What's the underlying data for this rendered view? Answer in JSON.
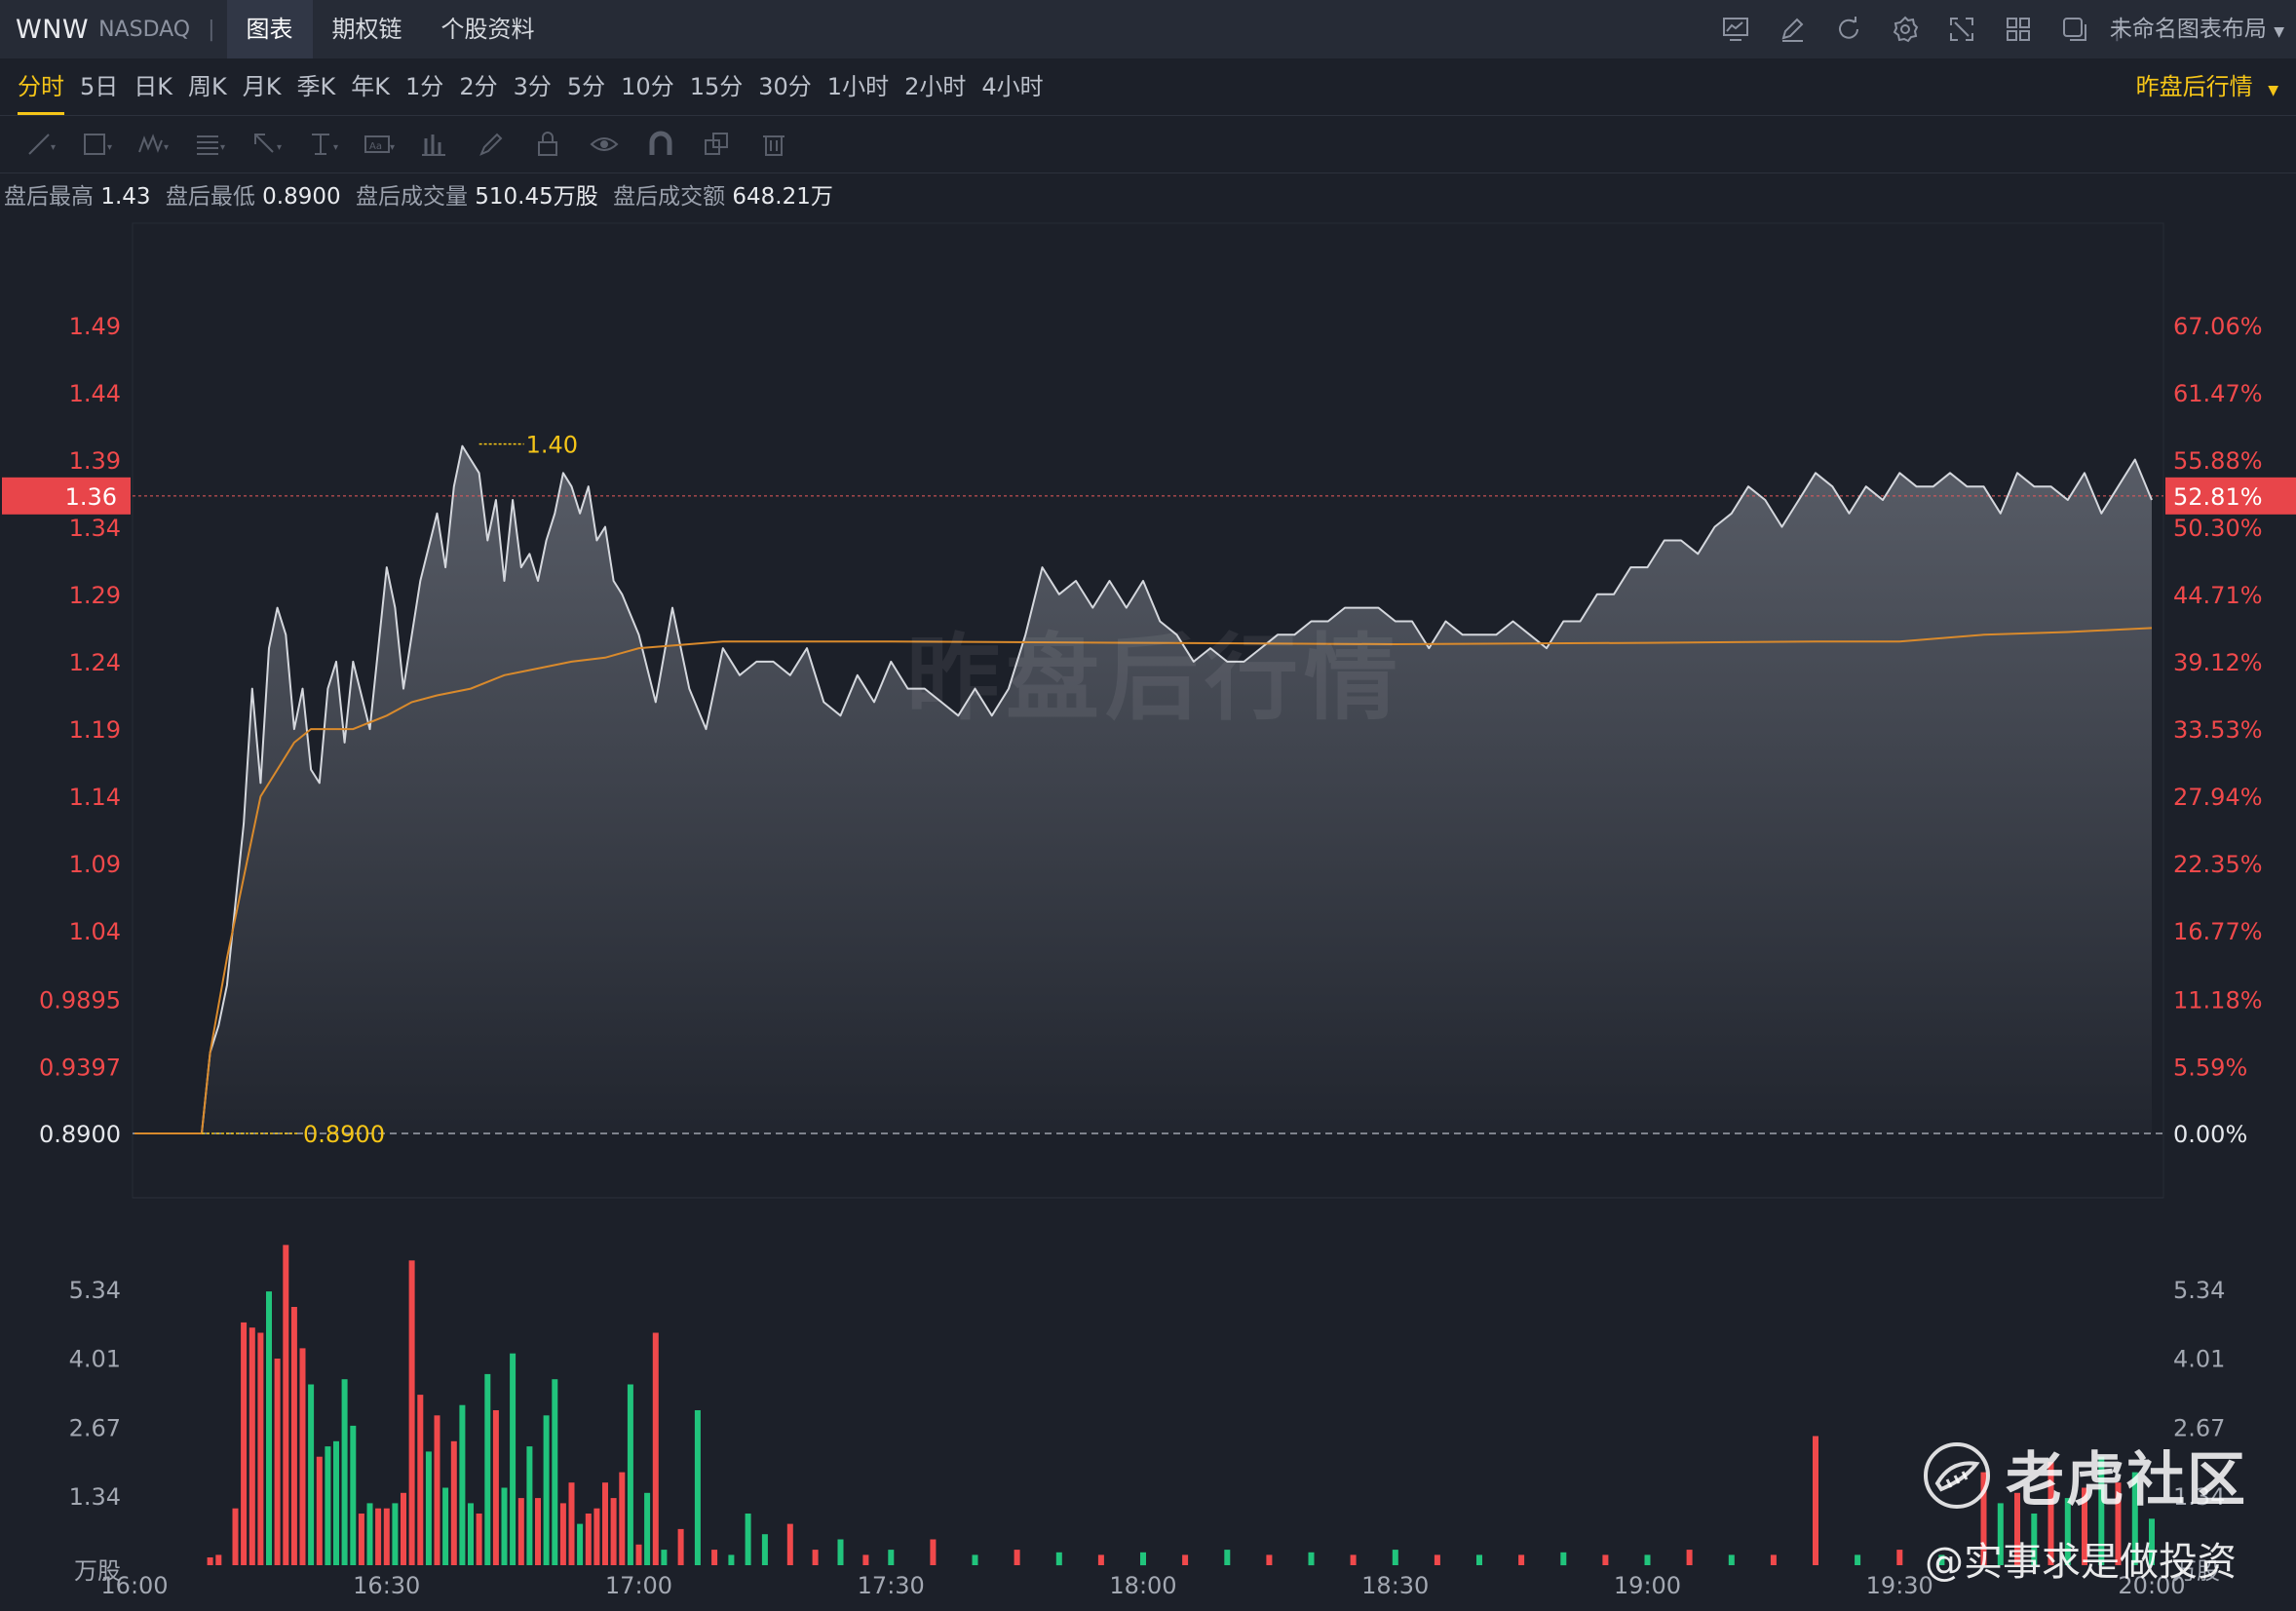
{
  "header": {
    "symbol": "WNW",
    "exchange": "NASDAQ",
    "separator": "|",
    "tabs": [
      {
        "label": "图表",
        "active": true
      },
      {
        "label": "期权链",
        "active": false
      },
      {
        "label": "个股资料",
        "active": false
      }
    ],
    "icons": [
      "chart-icon",
      "pencil-icon",
      "refresh-icon",
      "gear-icon",
      "fullscreen-icon",
      "grid-layout-icon",
      "window-icon"
    ],
    "layout_name": "未命名图表布局"
  },
  "periods": [
    {
      "label": "分时",
      "active": true
    },
    {
      "label": "5日"
    },
    {
      "label": "日K"
    },
    {
      "label": "周K"
    },
    {
      "label": "月K"
    },
    {
      "label": "季K"
    },
    {
      "label": "年K"
    },
    {
      "label": "1分"
    },
    {
      "label": "2分"
    },
    {
      "label": "3分"
    },
    {
      "label": "5分"
    },
    {
      "label": "10分"
    },
    {
      "label": "15分"
    },
    {
      "label": "30分"
    },
    {
      "label": "1小时"
    },
    {
      "label": "2小时"
    },
    {
      "label": "4小时"
    }
  ],
  "session_selector": "昨盘后行情",
  "drawing_tools": [
    "trendline-icon",
    "rectangle-icon",
    "wave-icon",
    "fib-icon",
    "arrow-icon",
    "text-cursor-icon",
    "text-box-icon",
    "bar-pattern-icon",
    "brush-icon",
    "lock-icon",
    "eye-icon",
    "magnet-icon",
    "layers-icon",
    "trash-icon"
  ],
  "stats": [
    {
      "label": "盘后最高",
      "value": "1.43"
    },
    {
      "label": "盘后最低",
      "value": "0.8900"
    },
    {
      "label": "盘后成交量",
      "value": "510.45万股"
    },
    {
      "label": "盘后成交额",
      "value": "648.21万"
    }
  ],
  "watermark": "昨盘后行情",
  "brand": {
    "name": "老虎社区",
    "handle": "@实事求是做投资"
  },
  "colors": {
    "up": "#f0494b",
    "down": "#21c47c",
    "accent": "#f5c518",
    "avg_line": "#d98a2c",
    "price_line": "#d4d7dd"
  },
  "chart_data": [
    {
      "type": "line",
      "name_price": "price",
      "ylim": [
        0.89,
        1.514
      ],
      "prev_close": 0.89,
      "left_ticks": [
        "1.49",
        "1.44",
        "1.39",
        "1.34",
        "1.29",
        "1.24",
        "1.19",
        "1.14",
        "1.09",
        "1.04",
        "0.9895",
        "0.9397",
        "0.8900"
      ],
      "left_tick_values": [
        1.4894,
        1.4396,
        1.3897,
        1.3398,
        1.2899,
        1.2401,
        1.1902,
        1.1403,
        1.0904,
        1.0405,
        0.9895,
        0.9397,
        0.89
      ],
      "right_ticks": [
        "67.06%",
        "61.47%",
        "55.88%",
        "50.30%",
        "44.71%",
        "39.12%",
        "33.53%",
        "27.94%",
        "22.35%",
        "16.77%",
        "11.18%",
        "5.59%",
        "0.00%"
      ],
      "current_price_label": "1.36",
      "current_price": 1.363,
      "current_pct_label": "52.81%",
      "high_marker_label": "1.40",
      "high_marker_value": 1.4,
      "high_marker_time": "16:41",
      "low_marker_label": "0.8900",
      "x_ticks": [
        "16:00",
        "16:30",
        "17:00",
        "17:30",
        "18:00",
        "18:30",
        "19:00",
        "19:30",
        "20:00"
      ],
      "x_range_minutes": [
        0,
        240
      ],
      "price_minutes": [
        0,
        8,
        9,
        10,
        11,
        12,
        13,
        14,
        15,
        16,
        17,
        18,
        19,
        20,
        21,
        22,
        23,
        24,
        25,
        26,
        28,
        30,
        31,
        32,
        33,
        34,
        36,
        37,
        38,
        39,
        40,
        41,
        42,
        43,
        44,
        45,
        46,
        47,
        48,
        49,
        50,
        51,
        52,
        53,
        54,
        55,
        56,
        57,
        58,
        60,
        62,
        64,
        66,
        68,
        70,
        72,
        74,
        76,
        78,
        80,
        82,
        84,
        86,
        88,
        90,
        92,
        94,
        96,
        98,
        100,
        102,
        104,
        106,
        108,
        110,
        112,
        114,
        116,
        118,
        120,
        122,
        124,
        126,
        128,
        130,
        132,
        134,
        136,
        138,
        140,
        142,
        144,
        146,
        148,
        150,
        152,
        154,
        156,
        158,
        160,
        162,
        164,
        166,
        168,
        170,
        172,
        174,
        176,
        178,
        180,
        182,
        184,
        186,
        188,
        190,
        192,
        194,
        196,
        198,
        200,
        202,
        204,
        206,
        208,
        210,
        212,
        214,
        216,
        218,
        220,
        222,
        224,
        226,
        228,
        230,
        232,
        234,
        236,
        238,
        240
      ],
      "price_values": [
        0.89,
        0.89,
        0.95,
        0.97,
        1.0,
        1.06,
        1.12,
        1.22,
        1.15,
        1.25,
        1.28,
        1.26,
        1.19,
        1.22,
        1.16,
        1.15,
        1.22,
        1.24,
        1.18,
        1.24,
        1.19,
        1.31,
        1.28,
        1.22,
        1.26,
        1.3,
        1.35,
        1.31,
        1.37,
        1.4,
        1.39,
        1.38,
        1.33,
        1.36,
        1.3,
        1.36,
        1.31,
        1.32,
        1.3,
        1.33,
        1.35,
        1.38,
        1.37,
        1.35,
        1.37,
        1.33,
        1.34,
        1.3,
        1.29,
        1.26,
        1.21,
        1.28,
        1.22,
        1.19,
        1.25,
        1.23,
        1.24,
        1.24,
        1.23,
        1.25,
        1.21,
        1.2,
        1.23,
        1.21,
        1.24,
        1.22,
        1.22,
        1.21,
        1.2,
        1.22,
        1.2,
        1.22,
        1.26,
        1.31,
        1.29,
        1.3,
        1.28,
        1.3,
        1.28,
        1.3,
        1.27,
        1.26,
        1.24,
        1.25,
        1.24,
        1.24,
        1.25,
        1.26,
        1.26,
        1.27,
        1.27,
        1.28,
        1.28,
        1.28,
        1.27,
        1.27,
        1.25,
        1.27,
        1.26,
        1.26,
        1.26,
        1.27,
        1.26,
        1.25,
        1.27,
        1.27,
        1.29,
        1.29,
        1.31,
        1.31,
        1.33,
        1.33,
        1.32,
        1.34,
        1.35,
        1.37,
        1.36,
        1.34,
        1.36,
        1.38,
        1.37,
        1.35,
        1.37,
        1.36,
        1.38,
        1.37,
        1.37,
        1.38,
        1.37,
        1.37,
        1.35,
        1.38,
        1.37,
        1.37,
        1.36,
        1.38,
        1.35,
        1.37,
        1.39,
        1.36
      ],
      "avg_minutes": [
        0,
        8,
        9,
        11,
        13,
        15,
        17,
        19,
        21,
        23,
        26,
        30,
        33,
        36,
        40,
        44,
        48,
        52,
        56,
        60,
        70,
        90,
        120,
        150,
        180,
        200,
        210,
        220,
        230,
        240
      ],
      "avg_values": [
        0.89,
        0.89,
        0.95,
        1.02,
        1.08,
        1.14,
        1.16,
        1.18,
        1.19,
        1.19,
        1.19,
        1.2,
        1.21,
        1.215,
        1.22,
        1.23,
        1.235,
        1.24,
        1.243,
        1.25,
        1.255,
        1.255,
        1.254,
        1.253,
        1.254,
        1.255,
        1.255,
        1.26,
        1.262,
        1.265
      ]
    },
    {
      "type": "bar",
      "name": "volume",
      "unit_label": "万股",
      "ylim": [
        0,
        7.0
      ],
      "y_ticks": [
        "5.34",
        "4.01",
        "2.67",
        "1.34"
      ],
      "y_tick_values": [
        5.34,
        4.01,
        2.67,
        1.34
      ],
      "minutes": [
        9,
        10,
        12,
        13,
        14,
        15,
        16,
        17,
        18,
        19,
        20,
        21,
        22,
        23,
        24,
        25,
        26,
        27,
        28,
        29,
        30,
        31,
        32,
        33,
        34,
        35,
        36,
        37,
        38,
        39,
        40,
        41,
        42,
        43,
        44,
        45,
        46,
        47,
        48,
        49,
        50,
        51,
        52,
        53,
        54,
        55,
        56,
        57,
        58,
        59,
        60,
        61,
        62,
        63,
        65,
        67,
        69,
        71,
        73,
        75,
        78,
        81,
        84,
        87,
        90,
        95,
        100,
        105,
        110,
        115,
        120,
        125,
        130,
        135,
        140,
        145,
        150,
        155,
        160,
        165,
        170,
        175,
        180,
        185,
        190,
        195,
        200,
        205,
        210,
        215,
        220,
        222,
        224,
        226,
        228,
        230,
        232,
        234,
        236,
        238,
        240
      ],
      "values": [
        0.15,
        0.2,
        1.1,
        4.7,
        4.6,
        4.5,
        5.3,
        4.0,
        6.2,
        5.0,
        4.2,
        3.5,
        2.1,
        2.3,
        2.4,
        3.6,
        2.7,
        1.0,
        1.2,
        1.1,
        1.1,
        1.2,
        1.4,
        5.9,
        3.3,
        2.2,
        2.9,
        1.5,
        2.4,
        3.1,
        1.2,
        1.0,
        3.7,
        3.0,
        1.5,
        4.1,
        1.3,
        2.3,
        1.3,
        2.9,
        3.6,
        1.2,
        1.6,
        0.8,
        1.0,
        1.1,
        1.6,
        1.3,
        1.8,
        3.5,
        0.4,
        1.4,
        4.5,
        0.3,
        0.7,
        3.0,
        0.3,
        0.2,
        1.0,
        0.6,
        0.8,
        0.3,
        0.5,
        0.2,
        0.3,
        0.5,
        0.2,
        0.3,
        0.25,
        0.2,
        0.25,
        0.2,
        0.3,
        0.2,
        0.25,
        0.2,
        0.3,
        0.2,
        0.2,
        0.2,
        0.25,
        0.2,
        0.2,
        0.3,
        0.2,
        0.2,
        2.5,
        0.2,
        0.3,
        0.2,
        1.8,
        1.2,
        1.4,
        1.0,
        2.0,
        1.3,
        1.5,
        2.1,
        1.6,
        1.8,
        0.9
      ],
      "directions": [
        "u",
        "u",
        "u",
        "u",
        "u",
        "u",
        "d",
        "u",
        "u",
        "u",
        "u",
        "d",
        "u",
        "d",
        "d",
        "d",
        "d",
        "u",
        "d",
        "u",
        "u",
        "d",
        "u",
        "u",
        "u",
        "d",
        "u",
        "d",
        "u",
        "d",
        "d",
        "u",
        "d",
        "u",
        "d",
        "d",
        "u",
        "d",
        "u",
        "d",
        "d",
        "u",
        "u",
        "d",
        "u",
        "u",
        "u",
        "u",
        "u",
        "d",
        "u",
        "d",
        "u",
        "d",
        "u",
        "d",
        "u",
        "d",
        "d",
        "d",
        "u",
        "u",
        "d",
        "u",
        "d",
        "u",
        "d",
        "u",
        "d",
        "u",
        "d",
        "u",
        "d",
        "u",
        "d",
        "u",
        "d",
        "u",
        "d",
        "u",
        "d",
        "u",
        "d",
        "u",
        "d",
        "u",
        "u",
        "d",
        "u",
        "d",
        "u",
        "d",
        "u",
        "d",
        "u",
        "d",
        "u",
        "d",
        "u",
        "d",
        "d"
      ]
    }
  ]
}
